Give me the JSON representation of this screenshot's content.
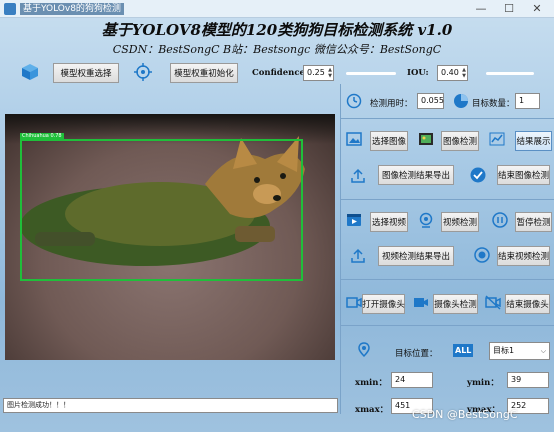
{
  "window": {
    "title": "基于YOLOv8的狗狗检测",
    "minimize": "—",
    "maximize": "☐",
    "close": "✕"
  },
  "header": {
    "title": "基于YOLOV8模型的120类狗狗目标检测系统 v1.0",
    "subtitle": "CSDN：BestSongC   B站：Bestsongc   微信公众号：BestSongC"
  },
  "toolbar": {
    "model_select": "模型权重选择",
    "model_init": "模型权重初始化",
    "confidence_label": "Confidence:",
    "confidence_value": "0.25",
    "confidence_level": 0.25,
    "iou_label": "IOU:",
    "iou_value": "0.40",
    "iou_level": 0.4
  },
  "stats": {
    "time_label": "检测用时：",
    "time_value": "0.055",
    "count_label": "目标数量：",
    "count_value": "1"
  },
  "image_section": {
    "select": "选择图像",
    "detect": "图像检测",
    "show_result": "结果展示",
    "export": "图像检测结果导出",
    "stop": "结束图像检测"
  },
  "video_section": {
    "select": "选择视频",
    "detect": "视频检测",
    "pause": "暂停检测",
    "export": "视频检测结果导出",
    "stop": "结束视频检测"
  },
  "camera_section": {
    "open": "打开摄像头",
    "detect": "摄像头检测",
    "stop": "结束摄像头"
  },
  "target": {
    "position_label": "目标位置：",
    "all_badge": "ALL",
    "select_value": "目标1",
    "xmin_label": "xmin：",
    "xmin": "24",
    "ymin_label": "ymin：",
    "ymin": "39",
    "xmax_label": "xmax：",
    "xmax": "451",
    "ymax_label": "ymax：",
    "ymax": "252"
  },
  "detection": {
    "label": "Chihuahua 0.78"
  },
  "status_text": "图片检测成功！！！",
  "watermark": "CSDN @BestSongC"
}
